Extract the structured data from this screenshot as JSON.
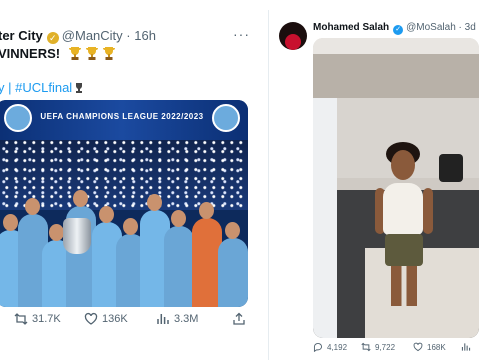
{
  "left_tweet": {
    "author_name": "ter City",
    "handle": "@ManCity",
    "separator": "·",
    "time": "16h",
    "more": "···",
    "text": "VINNERS!",
    "hashtags": "y | #UCLfinal",
    "banner_title": "UEFA CHAMPIONS LEAGUE 2022/2023",
    "stats": {
      "retweets": "31.7K",
      "likes": "136K",
      "views": "3.3M"
    }
  },
  "right_tweet": {
    "author_name": "Mohamed Salah",
    "handle": "@MoSalah",
    "separator": "·",
    "time": "3d",
    "stats": {
      "replies": "4,192",
      "retweets": "9,722",
      "likes": "168K"
    }
  },
  "icons": [
    "verified-badge-icon",
    "trophy-icon",
    "more-icon",
    "retweet-icon",
    "like-icon",
    "views-icon",
    "share-icon",
    "reply-icon"
  ],
  "colors": {
    "link": "#1d9bf0",
    "muted": "#536471",
    "verified_gold": "#e0b12a",
    "verified_blue": "#1d9bf0"
  }
}
